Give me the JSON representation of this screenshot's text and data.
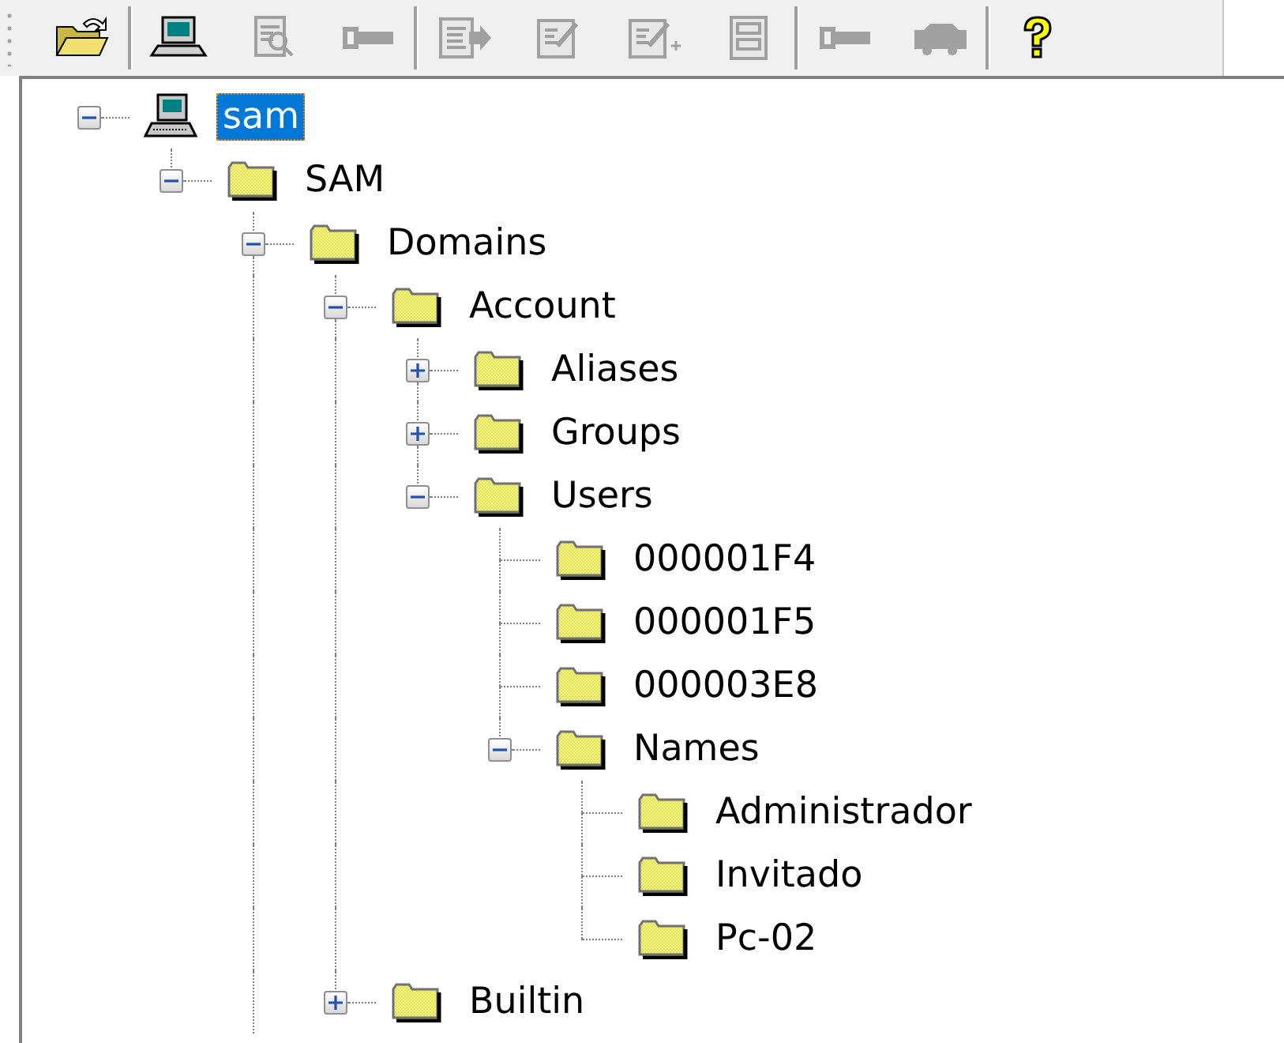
{
  "toolbar": [
    {
      "kind": "open",
      "disabled": false
    },
    {
      "kind": "separator"
    },
    {
      "kind": "computer",
      "disabled": false
    },
    {
      "kind": "find",
      "disabled": true
    },
    {
      "kind": "key",
      "disabled": true
    },
    {
      "kind": "separator"
    },
    {
      "kind": "export",
      "disabled": true
    },
    {
      "kind": "edit",
      "disabled": true
    },
    {
      "kind": "edit-add",
      "disabled": true
    },
    {
      "kind": "list",
      "disabled": true
    },
    {
      "kind": "separator"
    },
    {
      "kind": "key",
      "disabled": true
    },
    {
      "kind": "car",
      "disabled": true
    },
    {
      "kind": "separator"
    },
    {
      "kind": "help",
      "disabled": false
    }
  ],
  "tree": [
    {
      "label": "sam",
      "kind": "computer",
      "selected": true,
      "expanded": true,
      "children": [
        {
          "label": "SAM",
          "kind": "folder",
          "selected": false,
          "expanded": true,
          "children": [
            {
              "label": "Domains",
              "kind": "folder",
              "selected": false,
              "expanded": true,
              "more_below": true,
              "children": [
                {
                  "label": "Account",
                  "kind": "folder",
                  "selected": false,
                  "expanded": true,
                  "children": [
                    {
                      "label": "Aliases",
                      "kind": "folder",
                      "selected": false,
                      "expanded": false
                    },
                    {
                      "label": "Groups",
                      "kind": "folder",
                      "selected": false,
                      "expanded": false
                    },
                    {
                      "label": "Users",
                      "kind": "folder",
                      "selected": false,
                      "expanded": true,
                      "children": [
                        {
                          "label": "000001F4",
                          "kind": "folder",
                          "selected": false
                        },
                        {
                          "label": "000001F5",
                          "kind": "folder",
                          "selected": false
                        },
                        {
                          "label": "000003E8",
                          "kind": "folder",
                          "selected": false
                        },
                        {
                          "label": "Names",
                          "kind": "folder",
                          "selected": false,
                          "expanded": true,
                          "children": [
                            {
                              "label": "Administrador",
                              "kind": "folder",
                              "selected": false
                            },
                            {
                              "label": "Invitado",
                              "kind": "folder",
                              "selected": false
                            },
                            {
                              "label": "Pc-02",
                              "kind": "folder",
                              "selected": false
                            }
                          ]
                        }
                      ]
                    }
                  ]
                },
                {
                  "label": "Builtin",
                  "kind": "folder",
                  "selected": false,
                  "expanded": false
                }
              ]
            }
          ]
        }
      ]
    }
  ]
}
